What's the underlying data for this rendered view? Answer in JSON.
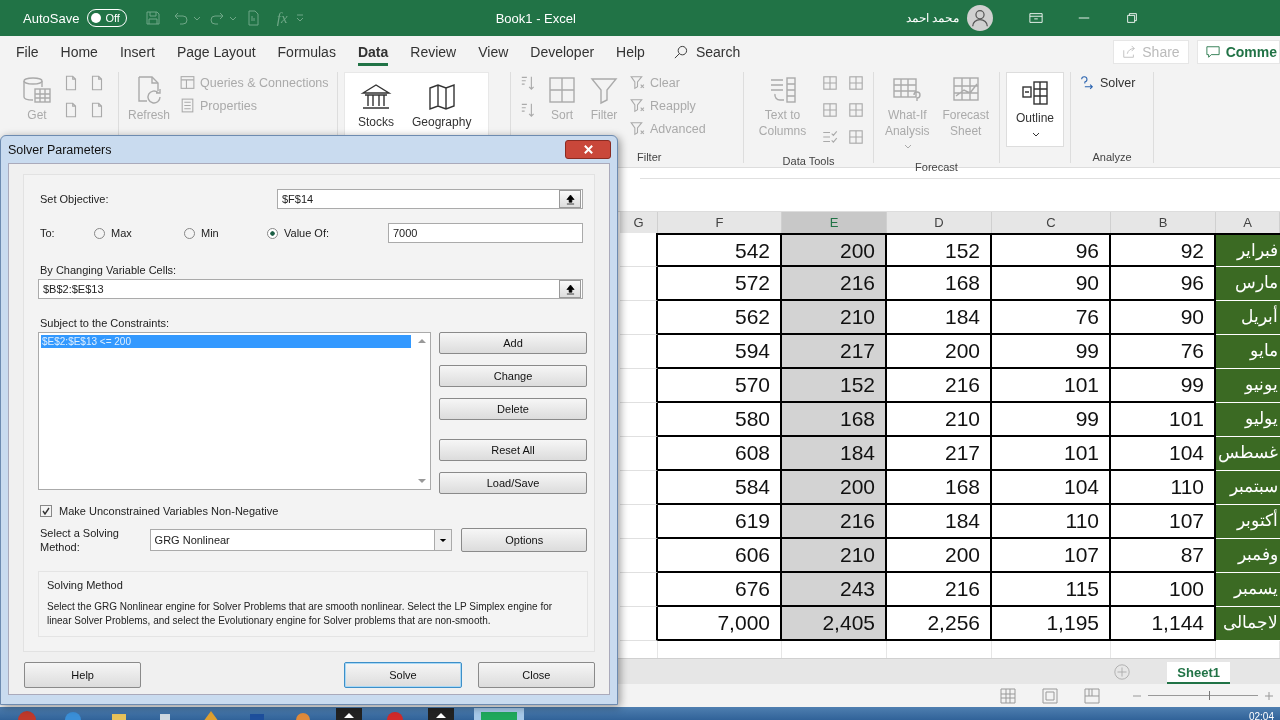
{
  "titlebar": {
    "autosave_label": "AutoSave",
    "autosave_toggle": {
      "label": "Off",
      "on": false
    },
    "function_label": "fx",
    "title": "Book1  -  Excel",
    "user": "محمد احمد"
  },
  "menu_tabs": [
    {
      "label": "File",
      "selected": false
    },
    {
      "label": "Home",
      "selected": false
    },
    {
      "label": "Insert",
      "selected": false
    },
    {
      "label": "Page Layout",
      "selected": false
    },
    {
      "label": "Formulas",
      "selected": false
    },
    {
      "label": "Data",
      "selected": true
    },
    {
      "label": "Review",
      "selected": false
    },
    {
      "label": "View",
      "selected": false
    },
    {
      "label": "Developer",
      "selected": false
    },
    {
      "label": "Help",
      "selected": false
    }
  ],
  "search": {
    "placeholder": "Search"
  },
  "share": {
    "label": "Share",
    "disabled": true
  },
  "comments": {
    "label": "Comme"
  },
  "ribbon": [
    {
      "items": [
        {
          "kind": "large",
          "label": "Get",
          "disabled": true
        },
        {
          "kind": "stack",
          "items": [
            {
              "kind": "icon",
              "disabled": true
            },
            {
              "kind": "icon",
              "disabled": true
            }
          ]
        },
        {
          "kind": "stack",
          "items": [
            {
              "kind": "icon",
              "disabled": true
            },
            {
              "kind": "icon",
              "disabled": true
            }
          ]
        }
      ]
    },
    {
      "items": [
        {
          "kind": "large",
          "label": "Refresh",
          "disabled": true
        },
        {
          "kind": "stack",
          "items": [
            {
              "kind": "small",
              "label": "Queries & Connections",
              "disabled": true
            },
            {
              "kind": "small",
              "label": "Properties",
              "disabled": true
            }
          ]
        }
      ]
    },
    {
      "items": [
        {
          "kind": "gallery",
          "items": [
            {
              "kind": "large",
              "label": "Stocks",
              "disabled": false
            },
            {
              "kind": "large",
              "label": "Geography",
              "disabled": false
            }
          ]
        }
      ]
    },
    {
      "label": "Filter",
      "items": [
        {
          "kind": "stack",
          "items": [
            {
              "kind": "icon",
              "disabled": true
            },
            {
              "kind": "icon",
              "disabled": true
            }
          ]
        },
        {
          "kind": "large",
          "label": "Sort",
          "disabled": true
        },
        {
          "kind": "large",
          "label": "Filter",
          "disabled": true
        },
        {
          "kind": "stack",
          "items": [
            {
              "kind": "small",
              "label": "Clear",
              "disabled": true
            },
            {
              "kind": "small",
              "label": "Reapply",
              "disabled": true
            },
            {
              "kind": "small",
              "label": "Advanced",
              "disabled": true
            }
          ]
        }
      ]
    },
    {
      "label": "Data Tools",
      "items": [
        {
          "kind": "large",
          "label": "Text to Columns",
          "disabled": true
        },
        {
          "kind": "stack",
          "items": [
            {
              "kind": "icon",
              "disabled": true
            },
            {
              "kind": "icon",
              "disabled": true
            },
            {
              "kind": "icon",
              "disabled": true
            }
          ]
        },
        {
          "kind": "stack",
          "items": [
            {
              "kind": "icon",
              "disabled": true
            },
            {
              "kind": "icon",
              "disabled": true
            },
            {
              "kind": "icon",
              "disabled": true
            }
          ]
        }
      ]
    },
    {
      "label": "Forecast",
      "items": [
        {
          "kind": "large",
          "label": "What-If Analysis",
          "disabled": true,
          "menu": true
        },
        {
          "kind": "large",
          "label": "Forecast Sheet",
          "disabled": true
        }
      ]
    },
    {
      "items": [
        {
          "kind": "large",
          "label": "Outline",
          "disabled": false,
          "menu": true
        }
      ]
    },
    {
      "label": "Analyze",
      "items": [
        {
          "kind": "small",
          "label": "Solver",
          "disabled": false
        }
      ]
    }
  ],
  "sheet": {
    "columns": [
      {
        "label": "G",
        "selected": false
      },
      {
        "label": "F",
        "selected": false
      },
      {
        "label": "E",
        "selected": true
      },
      {
        "label": "D",
        "selected": false
      },
      {
        "label": "C",
        "selected": false
      },
      {
        "label": "B",
        "selected": false
      },
      {
        "label": "A",
        "selected": false
      }
    ],
    "rows": [
      {
        "cells": [
          "542",
          "200",
          "152",
          "96",
          "92",
          "فبراير"
        ]
      },
      {
        "cells": [
          "572",
          "216",
          "168",
          "90",
          "96",
          "مارس"
        ]
      },
      {
        "cells": [
          "562",
          "210",
          "184",
          "76",
          "90",
          "أبريل"
        ]
      },
      {
        "cells": [
          "594",
          "217",
          "200",
          "99",
          "76",
          "مايو"
        ]
      },
      {
        "cells": [
          "570",
          "152",
          "216",
          "101",
          "99",
          "يونيو"
        ]
      },
      {
        "cells": [
          "580",
          "168",
          "210",
          "99",
          "101",
          "يوليو"
        ]
      },
      {
        "cells": [
          "608",
          "184",
          "217",
          "101",
          "104",
          "غسطس"
        ]
      },
      {
        "cells": [
          "584",
          "200",
          "168",
          "104",
          "110",
          "سبتمبر"
        ]
      },
      {
        "cells": [
          "619",
          "216",
          "184",
          "110",
          "107",
          "أكتوبر"
        ]
      },
      {
        "cells": [
          "606",
          "210",
          "200",
          "107",
          "87",
          "وفمبر"
        ]
      },
      {
        "cells": [
          "676",
          "243",
          "216",
          "115",
          "100",
          "يسمبر"
        ]
      },
      {
        "cells": [
          "7,000",
          "2,405",
          "2,256",
          "1,195",
          "1,144",
          "لاجمالى"
        ]
      }
    ]
  },
  "sheet_tabs": [
    {
      "label": "Sheet1",
      "selected": true
    }
  ],
  "zoom": {
    "level": 0.55
  },
  "taskbar": {
    "time": "02:04"
  },
  "dialog": {
    "title": "Solver Parameters",
    "objective": {
      "label": "Set Objective:",
      "value": "$F$14"
    },
    "to": {
      "label": "To:",
      "options": [
        {
          "label": "Max",
          "selected": false
        },
        {
          "label": "Min",
          "selected": false
        },
        {
          "label": "Value Of:",
          "selected": true
        }
      ],
      "value": "7000"
    },
    "variables": {
      "label": "By Changing Variable Cells:",
      "value": "$B$2:$E$13"
    },
    "constraints": {
      "label": "Subject to the Constraints:",
      "items": [
        {
          "text": "$E$2:$E$13 <= 200",
          "selected": true
        }
      ]
    },
    "constraint_buttons": [
      "Add",
      "Change",
      "Delete",
      "Reset All",
      "Load/Save"
    ],
    "nonnegative": {
      "label": "Make Unconstrained Variables Non-Negative",
      "checked": true
    },
    "method": {
      "label": "Select a Solving Method:",
      "value": "GRG Nonlinear",
      "options_button": "Options"
    },
    "description": {
      "title": "Solving Method",
      "text": "Select the GRG Nonlinear engine for Solver Problems that are smooth nonlinear. Select the LP Simplex engine for linear Solver Problems, and select the Evolutionary engine for Solver problems that are non-smooth."
    },
    "footer_buttons": [
      {
        "label": "Help",
        "default": false
      },
      {
        "label": "Solve",
        "default": true
      },
      {
        "label": "Close",
        "default": false
      }
    ]
  }
}
